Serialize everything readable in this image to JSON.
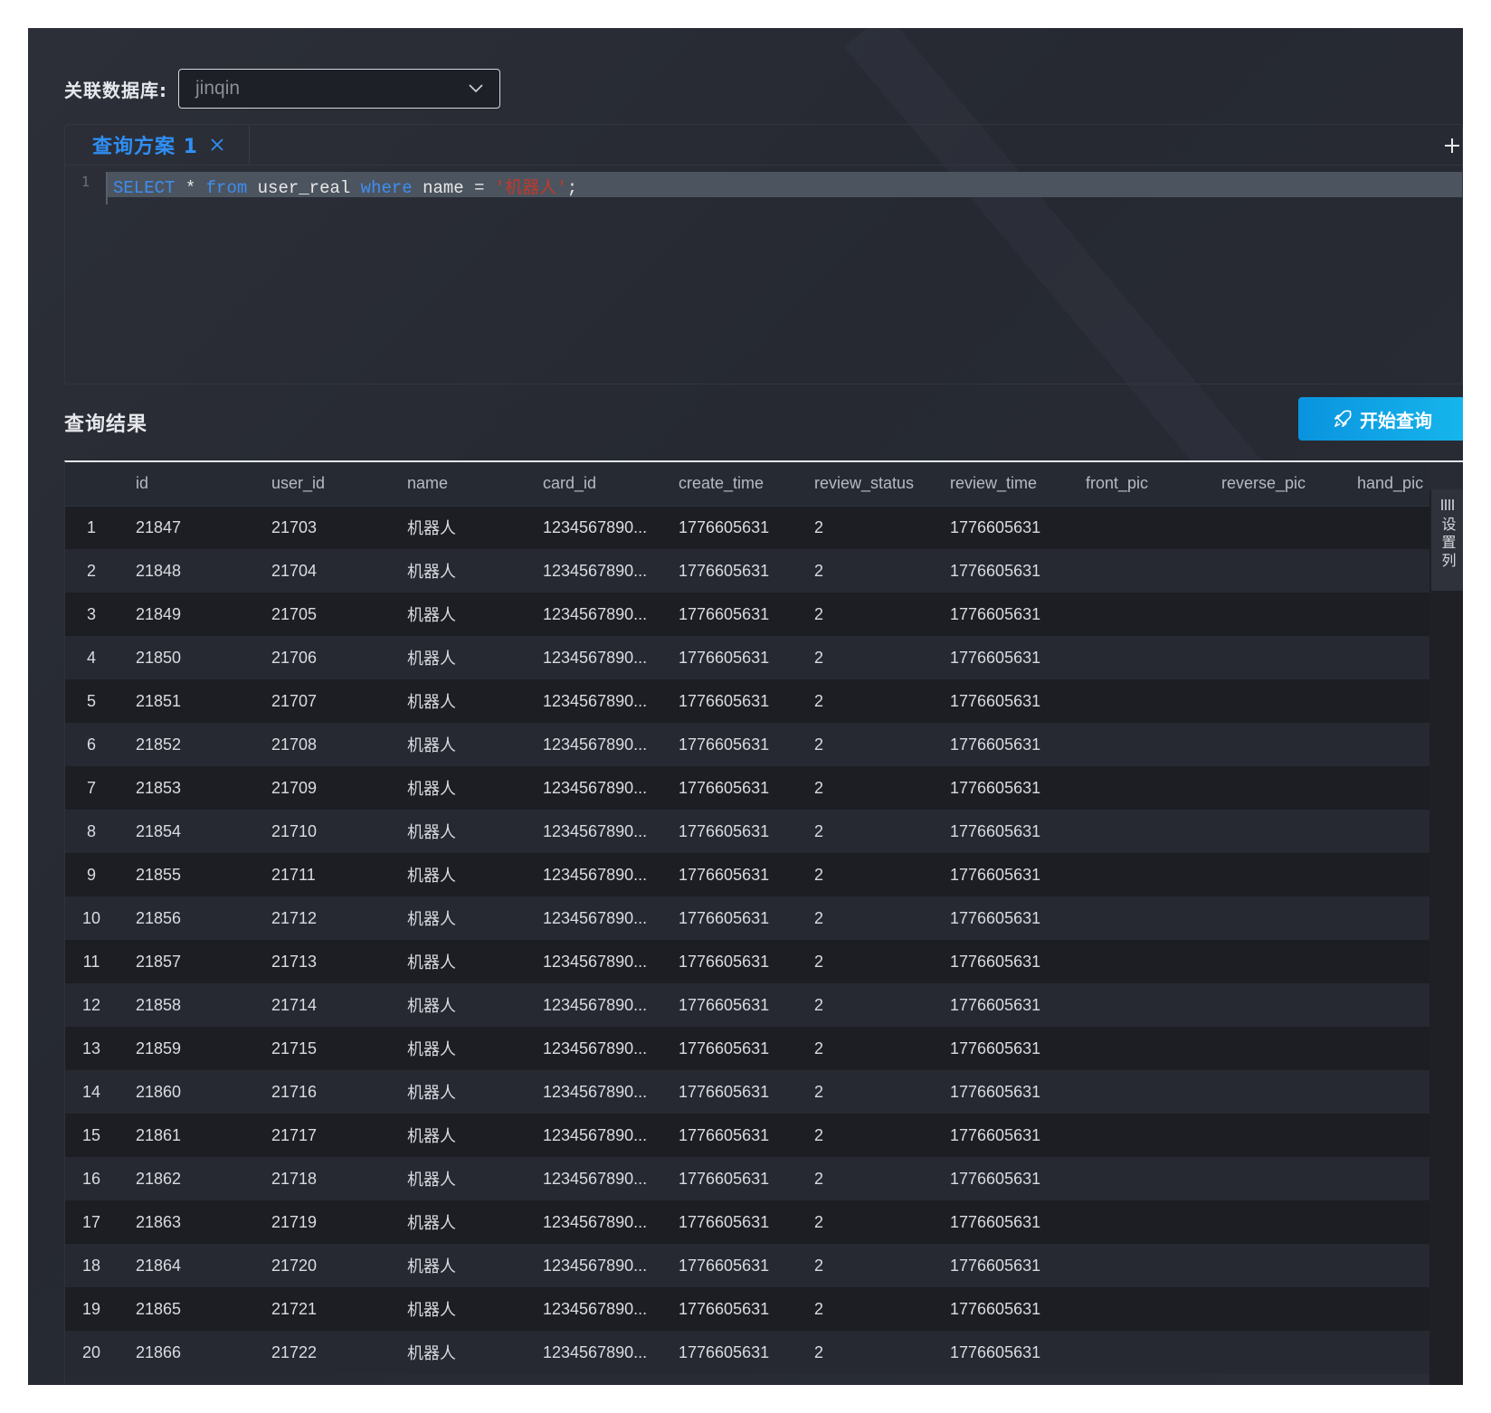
{
  "header": {
    "db_label": "关联数据库:",
    "db_value": "jinqin"
  },
  "editor": {
    "tab_label": "查询方案 1",
    "line_number": "1",
    "sql": {
      "kw_select": "SELECT",
      "star": " * ",
      "kw_from": "from",
      "table": " user_real ",
      "kw_where": "where",
      "cond": " name = ",
      "value": "'机器人'",
      "end": ";"
    }
  },
  "results": {
    "title": "查询结果",
    "run_button": "开始查询",
    "column_settings": "设置列",
    "columns": [
      "",
      "id",
      "user_id",
      "name",
      "card_id",
      "create_time",
      "review_status",
      "review_time",
      "front_pic",
      "reverse_pic",
      "hand_pic"
    ],
    "rows": [
      [
        "1",
        "21847",
        "21703",
        "机器人",
        "1234567890...",
        "1776605631",
        "2",
        "1776605631",
        "",
        "",
        ""
      ],
      [
        "2",
        "21848",
        "21704",
        "机器人",
        "1234567890...",
        "1776605631",
        "2",
        "1776605631",
        "",
        "",
        ""
      ],
      [
        "3",
        "21849",
        "21705",
        "机器人",
        "1234567890...",
        "1776605631",
        "2",
        "1776605631",
        "",
        "",
        ""
      ],
      [
        "4",
        "21850",
        "21706",
        "机器人",
        "1234567890...",
        "1776605631",
        "2",
        "1776605631",
        "",
        "",
        ""
      ],
      [
        "5",
        "21851",
        "21707",
        "机器人",
        "1234567890...",
        "1776605631",
        "2",
        "1776605631",
        "",
        "",
        ""
      ],
      [
        "6",
        "21852",
        "21708",
        "机器人",
        "1234567890...",
        "1776605631",
        "2",
        "1776605631",
        "",
        "",
        ""
      ],
      [
        "7",
        "21853",
        "21709",
        "机器人",
        "1234567890...",
        "1776605631",
        "2",
        "1776605631",
        "",
        "",
        ""
      ],
      [
        "8",
        "21854",
        "21710",
        "机器人",
        "1234567890...",
        "1776605631",
        "2",
        "1776605631",
        "",
        "",
        ""
      ],
      [
        "9",
        "21855",
        "21711",
        "机器人",
        "1234567890...",
        "1776605631",
        "2",
        "1776605631",
        "",
        "",
        ""
      ],
      [
        "10",
        "21856",
        "21712",
        "机器人",
        "1234567890...",
        "1776605631",
        "2",
        "1776605631",
        "",
        "",
        ""
      ],
      [
        "11",
        "21857",
        "21713",
        "机器人",
        "1234567890...",
        "1776605631",
        "2",
        "1776605631",
        "",
        "",
        ""
      ],
      [
        "12",
        "21858",
        "21714",
        "机器人",
        "1234567890...",
        "1776605631",
        "2",
        "1776605631",
        "",
        "",
        ""
      ],
      [
        "13",
        "21859",
        "21715",
        "机器人",
        "1234567890...",
        "1776605631",
        "2",
        "1776605631",
        "",
        "",
        ""
      ],
      [
        "14",
        "21860",
        "21716",
        "机器人",
        "1234567890...",
        "1776605631",
        "2",
        "1776605631",
        "",
        "",
        ""
      ],
      [
        "15",
        "21861",
        "21717",
        "机器人",
        "1234567890...",
        "1776605631",
        "2",
        "1776605631",
        "",
        "",
        ""
      ],
      [
        "16",
        "21862",
        "21718",
        "机器人",
        "1234567890...",
        "1776605631",
        "2",
        "1776605631",
        "",
        "",
        ""
      ],
      [
        "17",
        "21863",
        "21719",
        "机器人",
        "1234567890...",
        "1776605631",
        "2",
        "1776605631",
        "",
        "",
        ""
      ],
      [
        "18",
        "21864",
        "21720",
        "机器人",
        "1234567890...",
        "1776605631",
        "2",
        "1776605631",
        "",
        "",
        ""
      ],
      [
        "19",
        "21865",
        "21721",
        "机器人",
        "1234567890...",
        "1776605631",
        "2",
        "1776605631",
        "",
        "",
        ""
      ],
      [
        "20",
        "21866",
        "21722",
        "机器人",
        "1234567890...",
        "1776605631",
        "2",
        "1776605631",
        "",
        "",
        ""
      ]
    ]
  },
  "icons": {
    "dropdown": "chevron-down-icon",
    "close_tab": "close-icon",
    "add_tab": "plus-icon",
    "run": "rocket-icon",
    "settings": "columns-icon"
  },
  "colors": {
    "accent_blue": "#2f8ff5",
    "run_button": "#0fa6e6",
    "sql_keyword": "#3d8ef2",
    "sql_string": "#c0392b"
  }
}
